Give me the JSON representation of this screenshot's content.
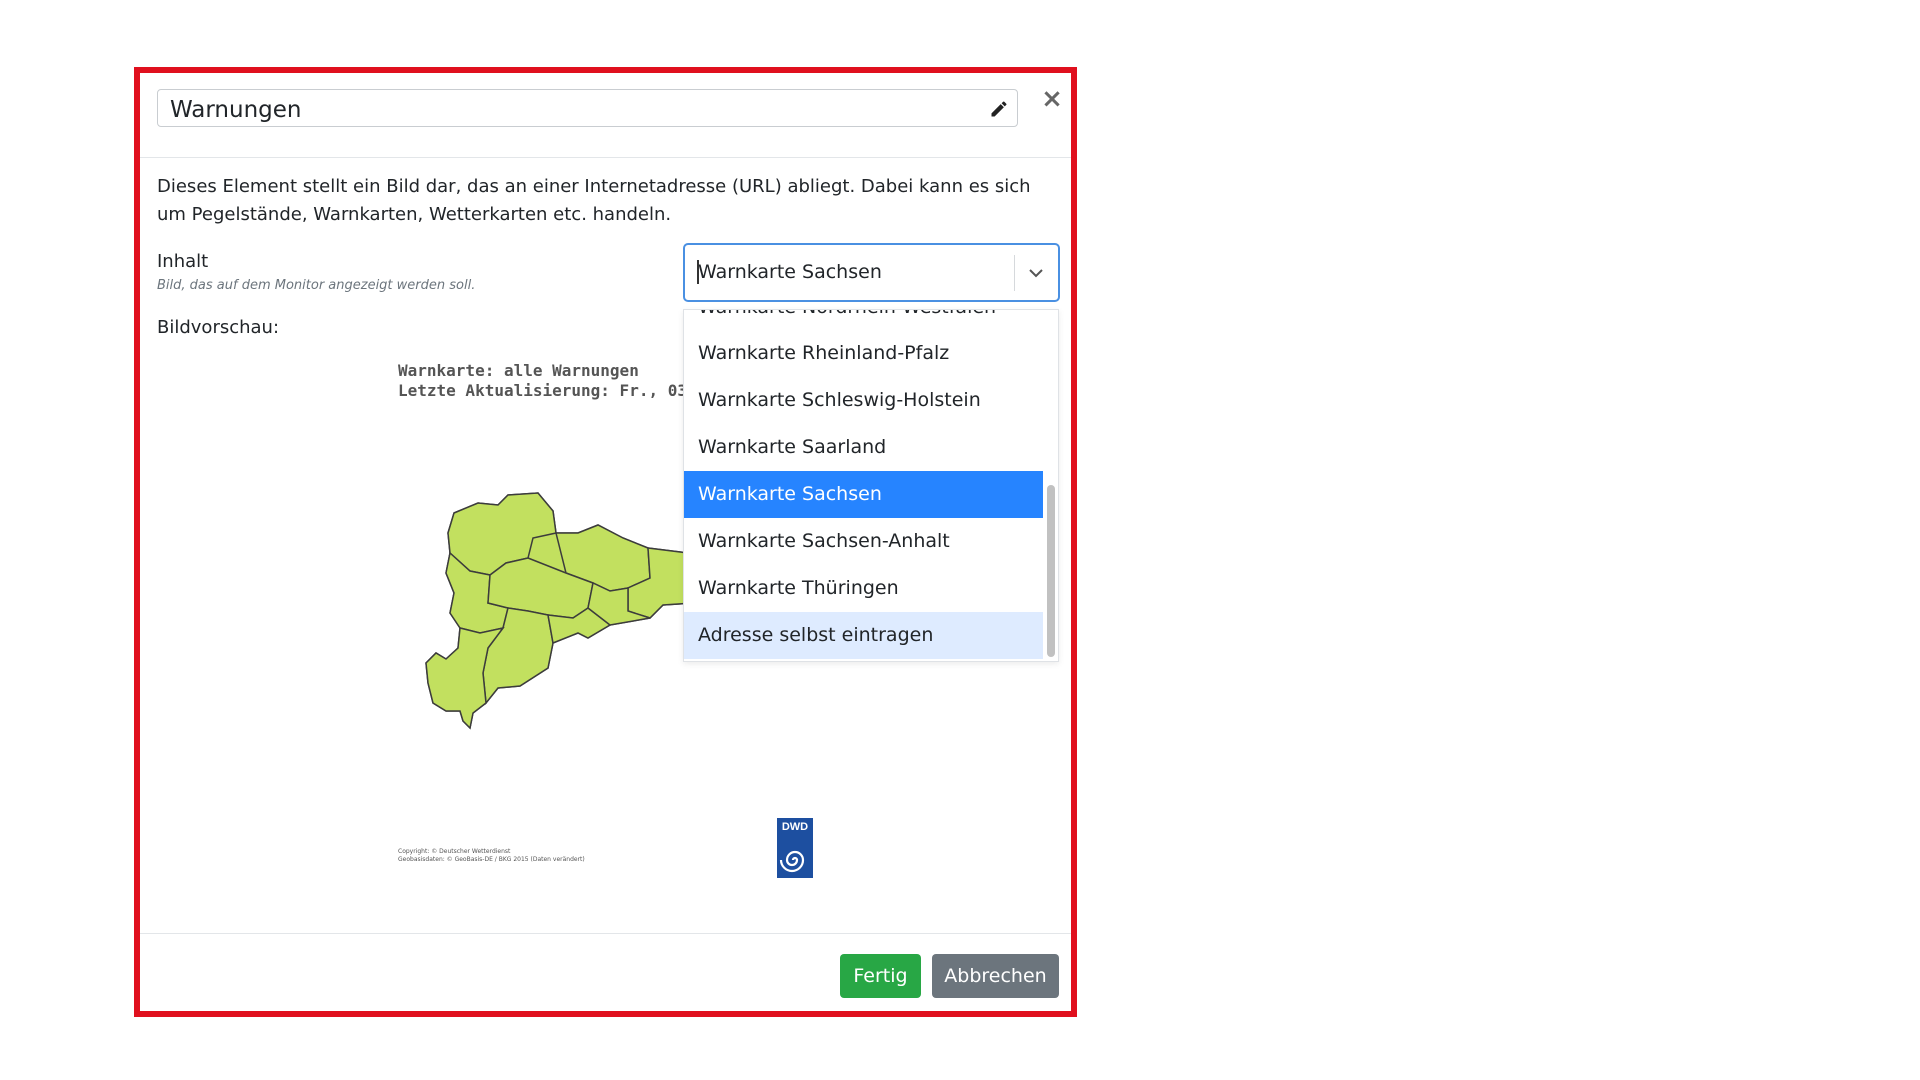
{
  "dialog": {
    "title": "Warnungen",
    "description": "Dieses Element stellt ein Bild dar, das an einer Internetadresse (URL) abliegt. Dabei kann es sich um Pegelstände, Warnkarten, Wetterkarten etc. handeln.",
    "close_symbol": "×",
    "icons": {
      "edit": "pencil-icon",
      "close": "close-icon"
    }
  },
  "content_field": {
    "label": "Inhalt",
    "hint": "Bild, das auf dem Monitor angezeigt werden soll.",
    "selected_value": "Warnkarte Sachsen",
    "options": [
      "Warnkarte Nordrhein-Westfalen",
      "Warnkarte Rheinland-Pfalz",
      "Warnkarte Schleswig-Holstein",
      "Warnkarte Saarland",
      "Warnkarte Sachsen",
      "Warnkarte Sachsen-Anhalt",
      "Warnkarte Thüringen",
      "Adresse selbst eintragen"
    ]
  },
  "preview": {
    "label": "Bildvorschau:",
    "map_title": "Warnkarte: alle Warnungen\nLetzte Aktualisierung: Fr., 03.",
    "copyright": "Copyright: © Deutscher Wetterdienst\nGeobasisdaten: © GeoBasis-DE / BKG 2015 (Daten verändert)",
    "logo_text": "DWD",
    "map_color": "#c2e05f"
  },
  "footer": {
    "ok_label": "Fertig",
    "cancel_label": "Abbrechen"
  },
  "colors": {
    "frame": "#e0101e",
    "accent": "#2684ff",
    "ok": "#28a745",
    "cancel": "#6c757d"
  }
}
